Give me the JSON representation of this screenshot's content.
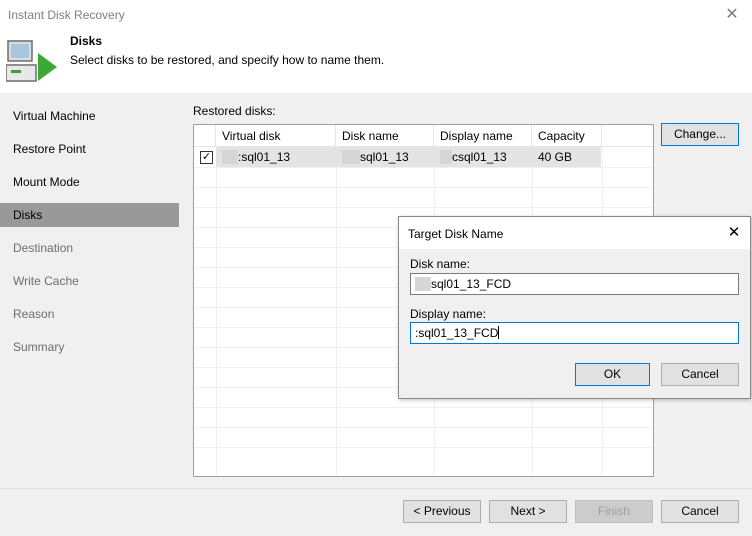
{
  "window": {
    "title": "Instant Disk Recovery",
    "close_glyph": "✕"
  },
  "header": {
    "title": "Disks",
    "subtitle": "Select disks to be restored, and specify how to name them.",
    "icon": "disk-restore-icon"
  },
  "sidebar": {
    "items": [
      {
        "label": "Virtual Machine",
        "state": "enabled"
      },
      {
        "label": "Restore Point",
        "state": "enabled"
      },
      {
        "label": "Mount Mode",
        "state": "enabled"
      },
      {
        "label": "Disks",
        "state": "active"
      },
      {
        "label": "Destination",
        "state": "disabled"
      },
      {
        "label": "Write Cache",
        "state": "disabled"
      },
      {
        "label": "Reason",
        "state": "disabled"
      },
      {
        "label": "Summary",
        "state": "disabled"
      }
    ]
  },
  "main": {
    "restored_label": "Restored disks:",
    "change_button": "Change...",
    "table": {
      "columns": [
        "Virtual disk",
        "Disk name",
        "Display name",
        "Capacity"
      ],
      "rows": [
        {
          "checked": true,
          "virtual_disk": ":sql01_13",
          "disk_name": "sql01_13",
          "display_name": "csql01_13",
          "capacity": "40 GB"
        }
      ]
    }
  },
  "footer": {
    "previous": "< Previous",
    "next": "Next >",
    "finish": "Finish",
    "cancel": "Cancel"
  },
  "dialog": {
    "title": "Target Disk Name",
    "close_glyph": "✕",
    "disk_name_label": "Disk name:",
    "disk_name_value": "sql01_13_FCD",
    "display_name_label": "Display name:",
    "display_name_value": ":sql01_13_FCD",
    "ok": "OK",
    "cancel": "Cancel"
  },
  "colors": {
    "active_nav": "#999999",
    "focus_border": "#0078d7",
    "panel_bg": "#f0f0f0"
  }
}
